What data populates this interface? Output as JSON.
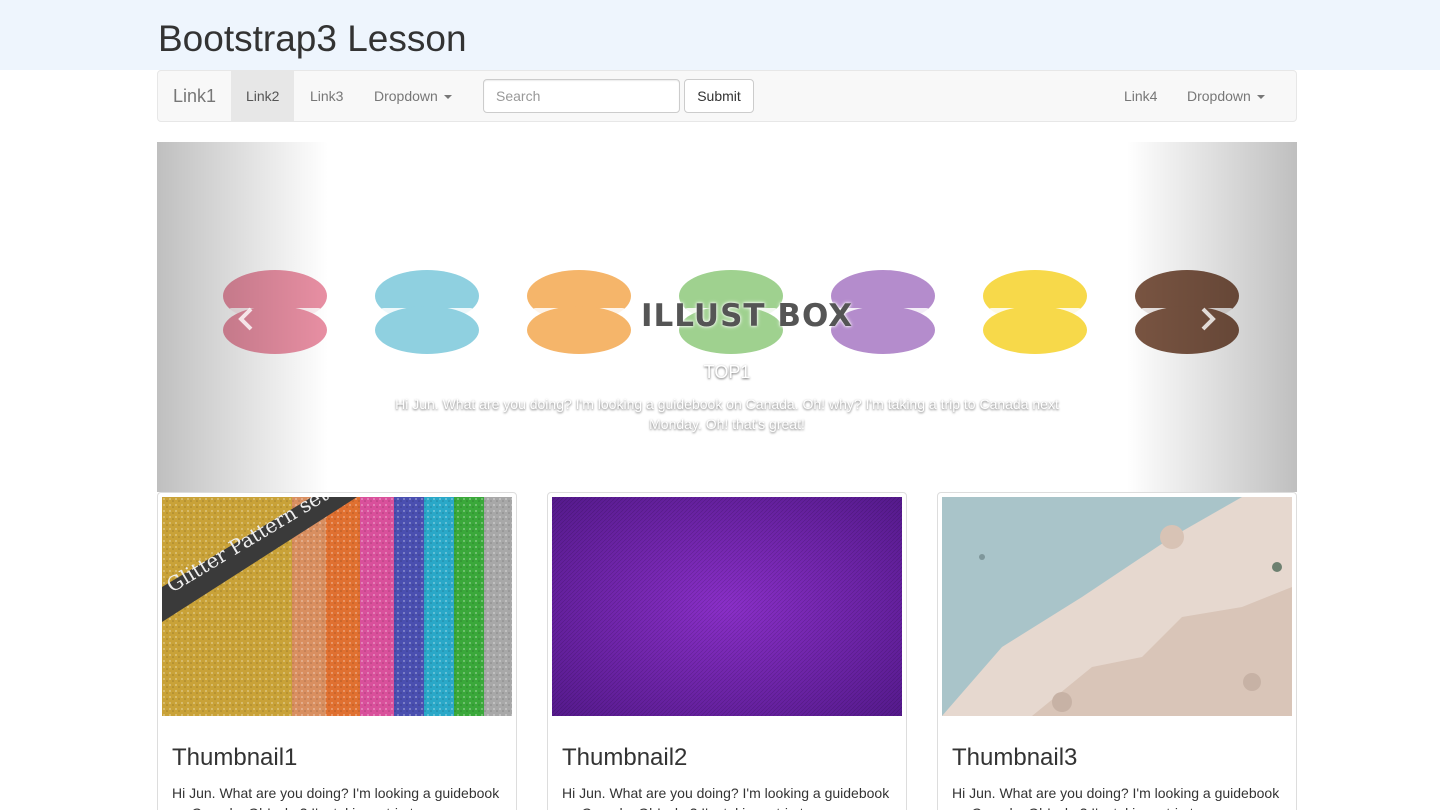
{
  "header": {
    "title": "Bootstrap3 Lesson"
  },
  "navbar": {
    "brand": "Link1",
    "items": [
      {
        "label": "Link2",
        "active": true
      },
      {
        "label": "Link3",
        "active": false
      },
      {
        "label": "Dropdown",
        "dropdown": true
      }
    ],
    "search": {
      "placeholder": "Search",
      "value": ""
    },
    "submit_label": "Submit",
    "right_items": [
      {
        "label": "Link4"
      },
      {
        "label": "Dropdown",
        "dropdown": true
      }
    ]
  },
  "carousel": {
    "watermark": "ILLUST BOX",
    "caption_title": "TOP1",
    "caption_text": "Hi Jun. What are you doing? I'm looking a guidebook on Canada. Oh! why? I'm taking a trip to Canada next Monday. Oh! that's great!",
    "prev_icon": "chevron-left-icon",
    "next_icon": "chevron-right-icon",
    "macaron_colors": [
      "#e88fa3",
      "#8fd0e0",
      "#f5b56a",
      "#9fd18f",
      "#b48ccc",
      "#f7d94a",
      "#7a5542"
    ]
  },
  "thumbnails": [
    {
      "title": "Thumbnail1",
      "text": "Hi Jun. What are you doing? I'm looking a guidebook on Canada. Oh! why? I'm taking a trip to",
      "image_label": "Glitter Pattern set"
    },
    {
      "title": "Thumbnail2",
      "text": "Hi Jun. What are you doing? I'm looking a guidebook on Canada. Oh! why? I'm taking a trip to"
    },
    {
      "title": "Thumbnail3",
      "text": "Hi Jun. What are you doing? I'm looking a guidebook on Canada. Oh! why? I'm taking a trip to"
    }
  ]
}
